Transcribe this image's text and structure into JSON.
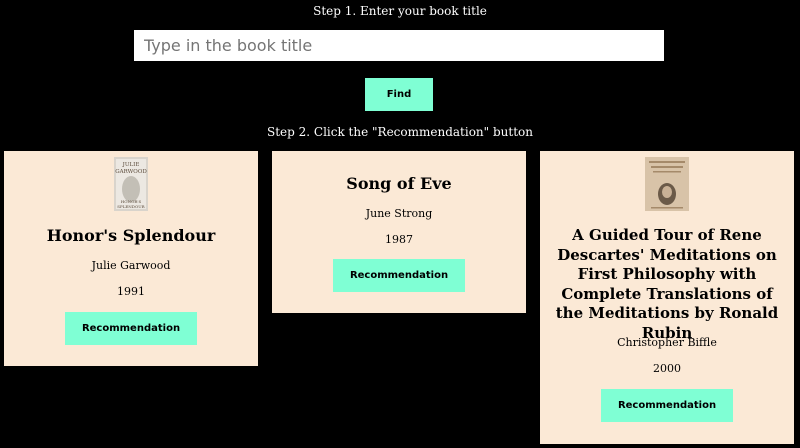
{
  "step1": {
    "label": "Step 1. Enter your book title"
  },
  "search": {
    "placeholder": "Type in the book title",
    "value": ""
  },
  "find_button": {
    "label": "Find"
  },
  "step2": {
    "label": "Step 2. Click the \"Recommendation\" button"
  },
  "colors": {
    "background": "#000000",
    "card": "#fbe9d6",
    "button": "#7fffd4"
  },
  "books": [
    {
      "title": "Honor's Splendour",
      "author": "Julie Garwood",
      "year": "1991",
      "cover": "book-cover-image",
      "cover_text": [
        "JULIE",
        "GARWOOD",
        "HONOR'S",
        "SPLENDOUR"
      ],
      "button_label": "Recommendation"
    },
    {
      "title": "Song of Eve",
      "author": "June Strong",
      "year": "1987",
      "button_label": "Recommendation"
    },
    {
      "title": "A Guided Tour of Rene Descartes' Meditations on First Philosophy with Complete Translations of the Meditations by Ronald Rubin",
      "author": "Christopher Biffle",
      "year": "2000",
      "cover": "book-cover-image",
      "button_label": "Recommendation"
    }
  ]
}
